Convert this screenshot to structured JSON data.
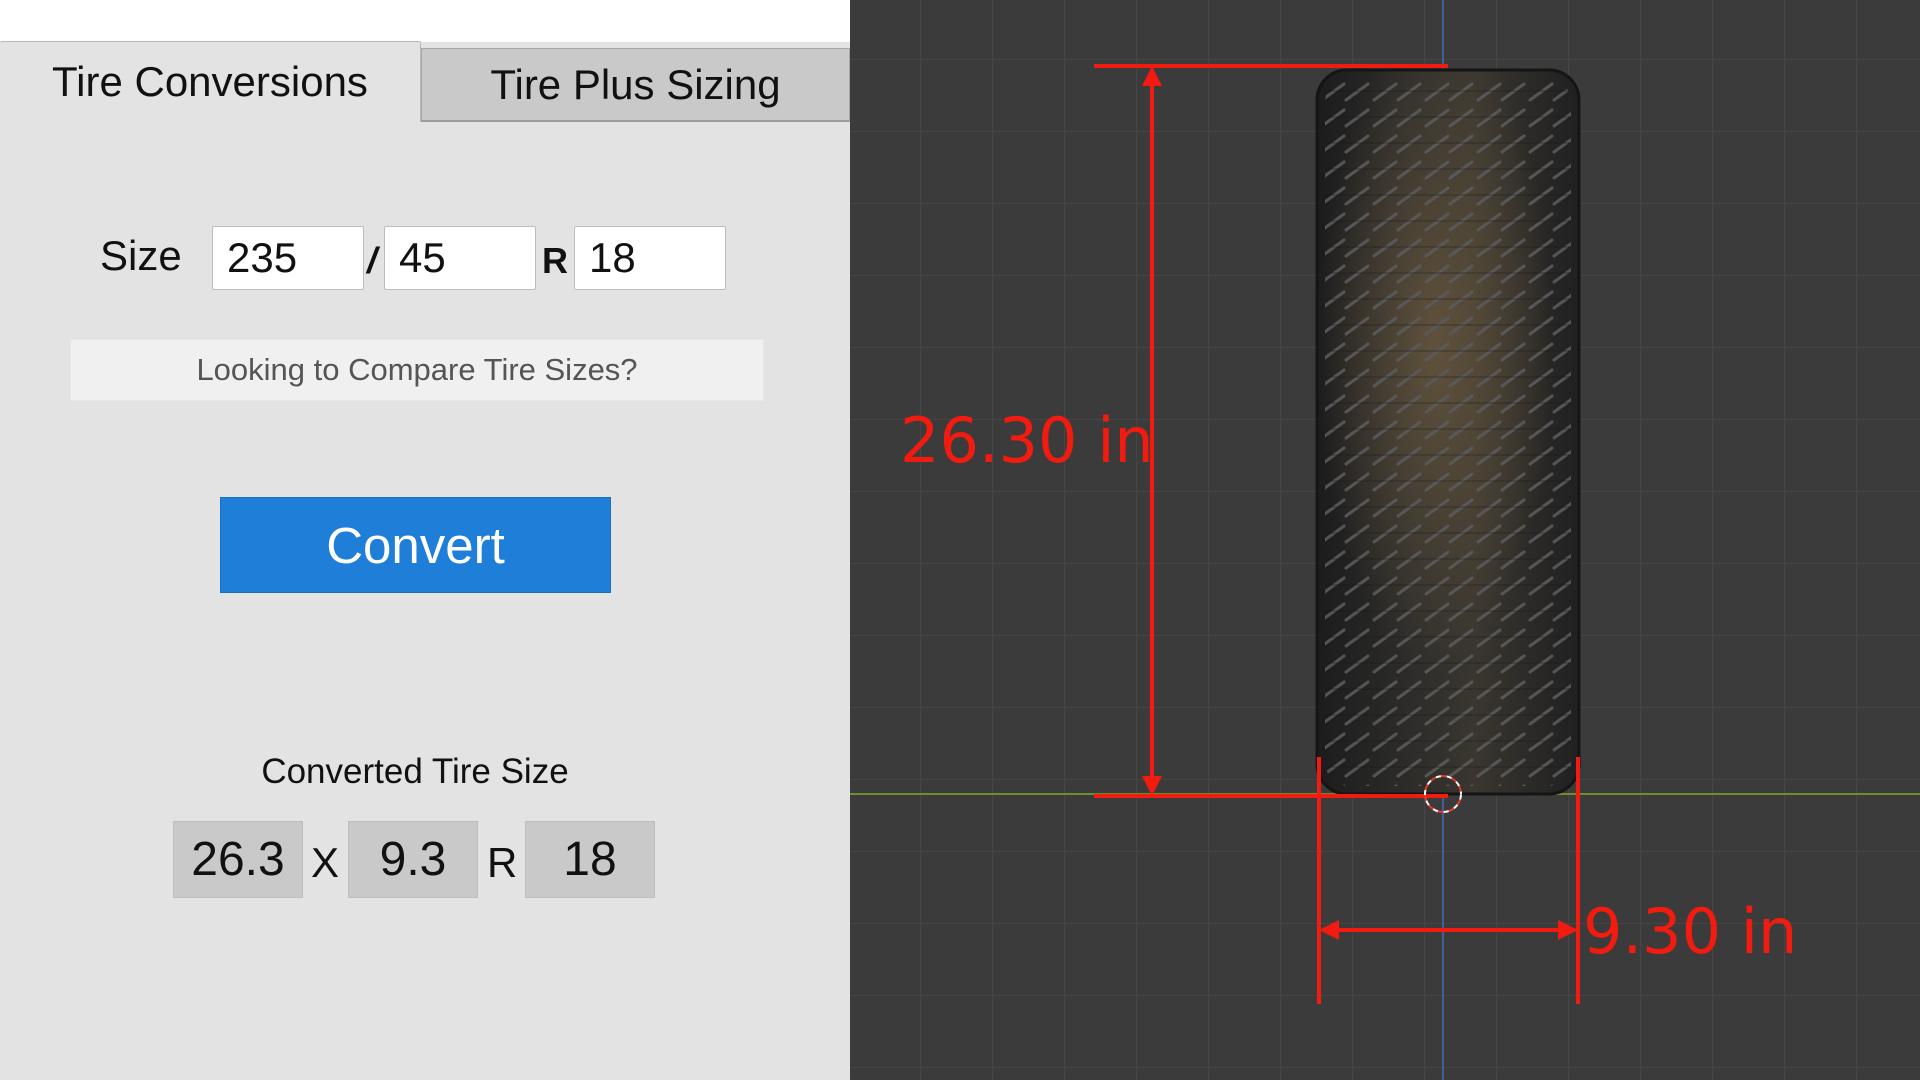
{
  "tabs": [
    {
      "label": "Tire Conversions",
      "active": true
    },
    {
      "label": "Tire Plus Sizing",
      "active": false
    }
  ],
  "size_form": {
    "label": "Size",
    "width": "235",
    "separator": "/",
    "aspect_ratio": "45",
    "construction": "R",
    "rim": "18"
  },
  "compare_link": "Looking to Compare Tire Sizes?",
  "convert_button": "Convert",
  "result": {
    "title": "Converted Tire Size",
    "diameter": "26.3",
    "separator_x": "X",
    "width": "9.3",
    "separator_r": "R",
    "rim": "18"
  },
  "viewport": {
    "height_dimension": "26.30 in",
    "width_dimension": "9.30 in",
    "dimension_color": "#f21b0f",
    "background_color": "#3b3b3b"
  }
}
